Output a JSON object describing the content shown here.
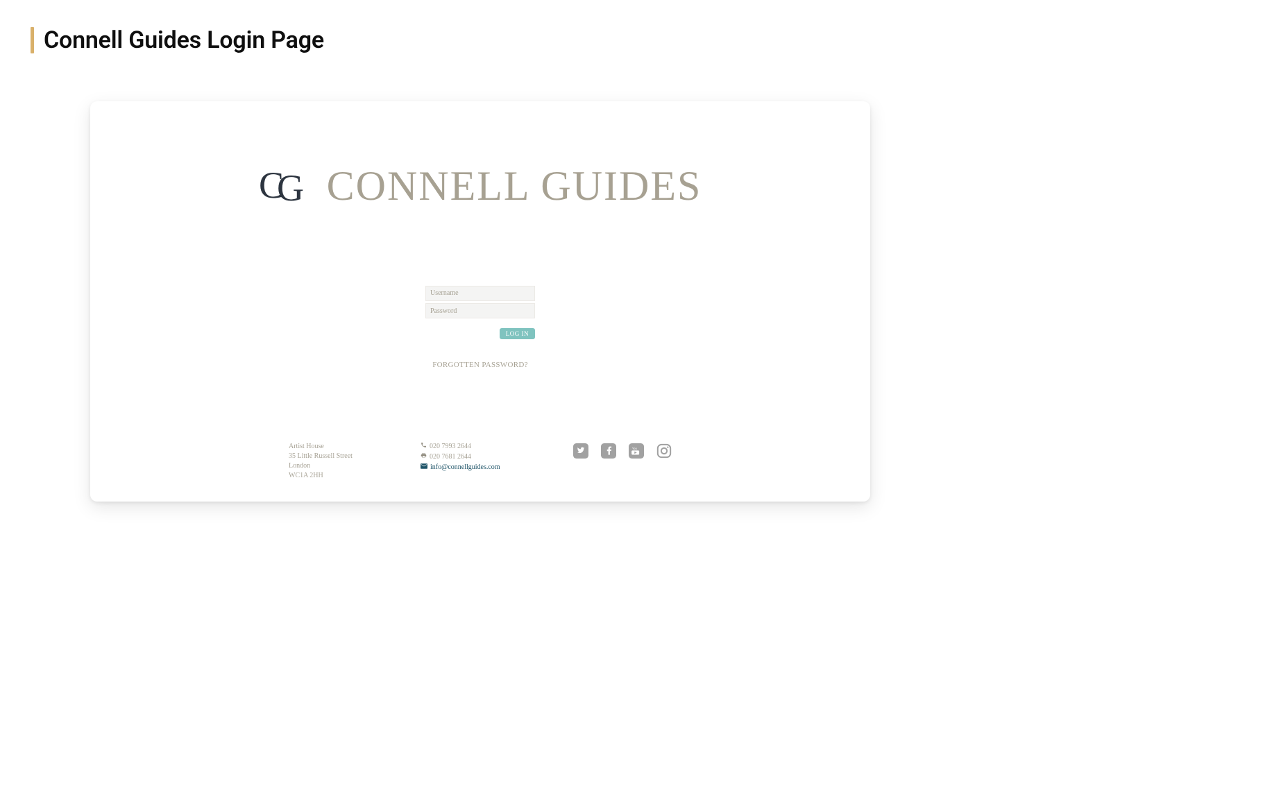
{
  "page": {
    "title": "Connell Guides Login Page"
  },
  "logo": {
    "text": "CONNELL GUIDES"
  },
  "form": {
    "username_placeholder": "Username",
    "password_placeholder": "Password",
    "login_label": "LOG IN",
    "forgot_label": "FORGOTTEN PASSWORD?"
  },
  "footer": {
    "address": {
      "line1": "Artist House",
      "line2": "35 Little Russell Street",
      "line3": "London",
      "line4": "WC1A 2HH"
    },
    "contact": {
      "phone": "020 7993 2644",
      "fax": "020 7681 2644",
      "email": "info@connellguides.com"
    },
    "social": {
      "twitter": "twitter",
      "facebook": "facebook",
      "youtube": "youtube",
      "instagram": "instagram"
    }
  }
}
